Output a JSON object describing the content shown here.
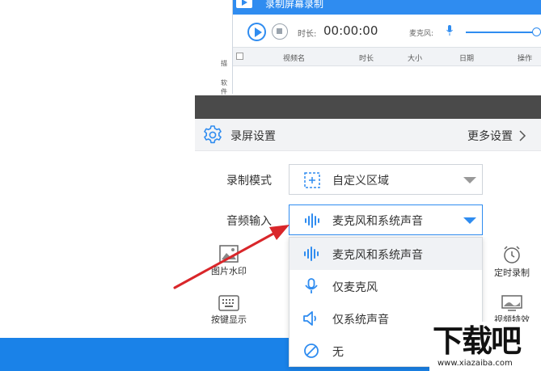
{
  "recorder": {
    "title": "录制屏幕录制",
    "duration_label": "时长:",
    "duration_value": "00:00:00",
    "mic_label": "麦克风:",
    "table_columns": [
      "视频名",
      "时长",
      "大小",
      "日期",
      "操作"
    ],
    "side_labels": [
      "描",
      "软件"
    ]
  },
  "settings": {
    "title": "录屏设置",
    "more": "更多设置",
    "record_mode_label": "录制模式",
    "record_mode_value": "自定义区域",
    "audio_input_label": "音频输入",
    "audio_input_value": "麦克风和系统声音"
  },
  "tools": {
    "image_watermark": "图片水印",
    "key_display": "按键显示",
    "scheduled_recording": "定时录制",
    "video_effects": "视频特效"
  },
  "dropdown": {
    "options": [
      "麦克风和系统声音",
      "仅麦克风",
      "仅系统声音",
      "无"
    ],
    "selected_index": 0
  },
  "watermark": {
    "brand": "下载吧",
    "url": "www.xiazaiba.com"
  },
  "colors": {
    "accent": "#2f8cf0",
    "bottom_bar": "#1a82e8",
    "arrow": "#d9262a"
  }
}
